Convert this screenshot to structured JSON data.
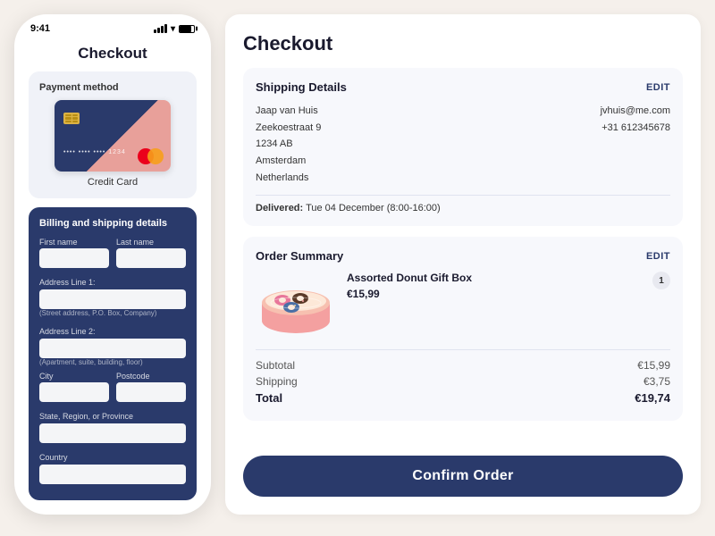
{
  "statusBar": {
    "time": "9:41"
  },
  "phone": {
    "title": "Checkout",
    "paymentSection": {
      "label": "Payment method",
      "cardNumber": "•••• •••• •••• 1234",
      "cardName": "Credit Card"
    },
    "billingSection": {
      "title": "Billing and shipping details",
      "fields": {
        "firstName": {
          "label": "First name",
          "placeholder": ""
        },
        "lastName": {
          "label": "Last name",
          "placeholder": ""
        },
        "addressLine1": {
          "label": "Address Line 1:",
          "placeholder": ""
        },
        "addressHint1": "(Street address, P.O. Box, Company)",
        "addressLine2": {
          "label": "Address Line 2:",
          "placeholder": ""
        },
        "addressHint2": "(Apartment, suite, building, floor)",
        "city": {
          "label": "City",
          "placeholder": ""
        },
        "postcode": {
          "label": "Postcode",
          "placeholder": ""
        },
        "stateRegion": {
          "label": "State, Region, or Province",
          "placeholder": ""
        },
        "country": {
          "label": "Country",
          "placeholder": ""
        }
      }
    }
  },
  "checkout": {
    "title": "Checkout",
    "shippingDetails": {
      "sectionTitle": "Shipping Details",
      "editLabel": "EDIT",
      "name": "Jaap van Huis",
      "address": "Zeekoestraat 9",
      "postalCity": "1234 AB",
      "city": "Amsterdam",
      "country": "Netherlands",
      "email": "jvhuis@me.com",
      "phone": "+31 612345678",
      "deliveryLabel": "Delivered:",
      "deliveryDate": "Tue 04 December (8:00-16:00)"
    },
    "orderSummary": {
      "sectionTitle": "Order Summary",
      "editLabel": "EDIT",
      "item": {
        "qty": "1",
        "name": "Assorted Donut Gift Box",
        "price": "€15,99"
      },
      "subtotalLabel": "Subtotal",
      "subtotalValue": "€15,99",
      "shippingLabel": "Shipping",
      "shippingValue": "€3,75",
      "totalLabel": "Total",
      "totalValue": "€19,74"
    },
    "confirmButton": "Confirm Order"
  }
}
